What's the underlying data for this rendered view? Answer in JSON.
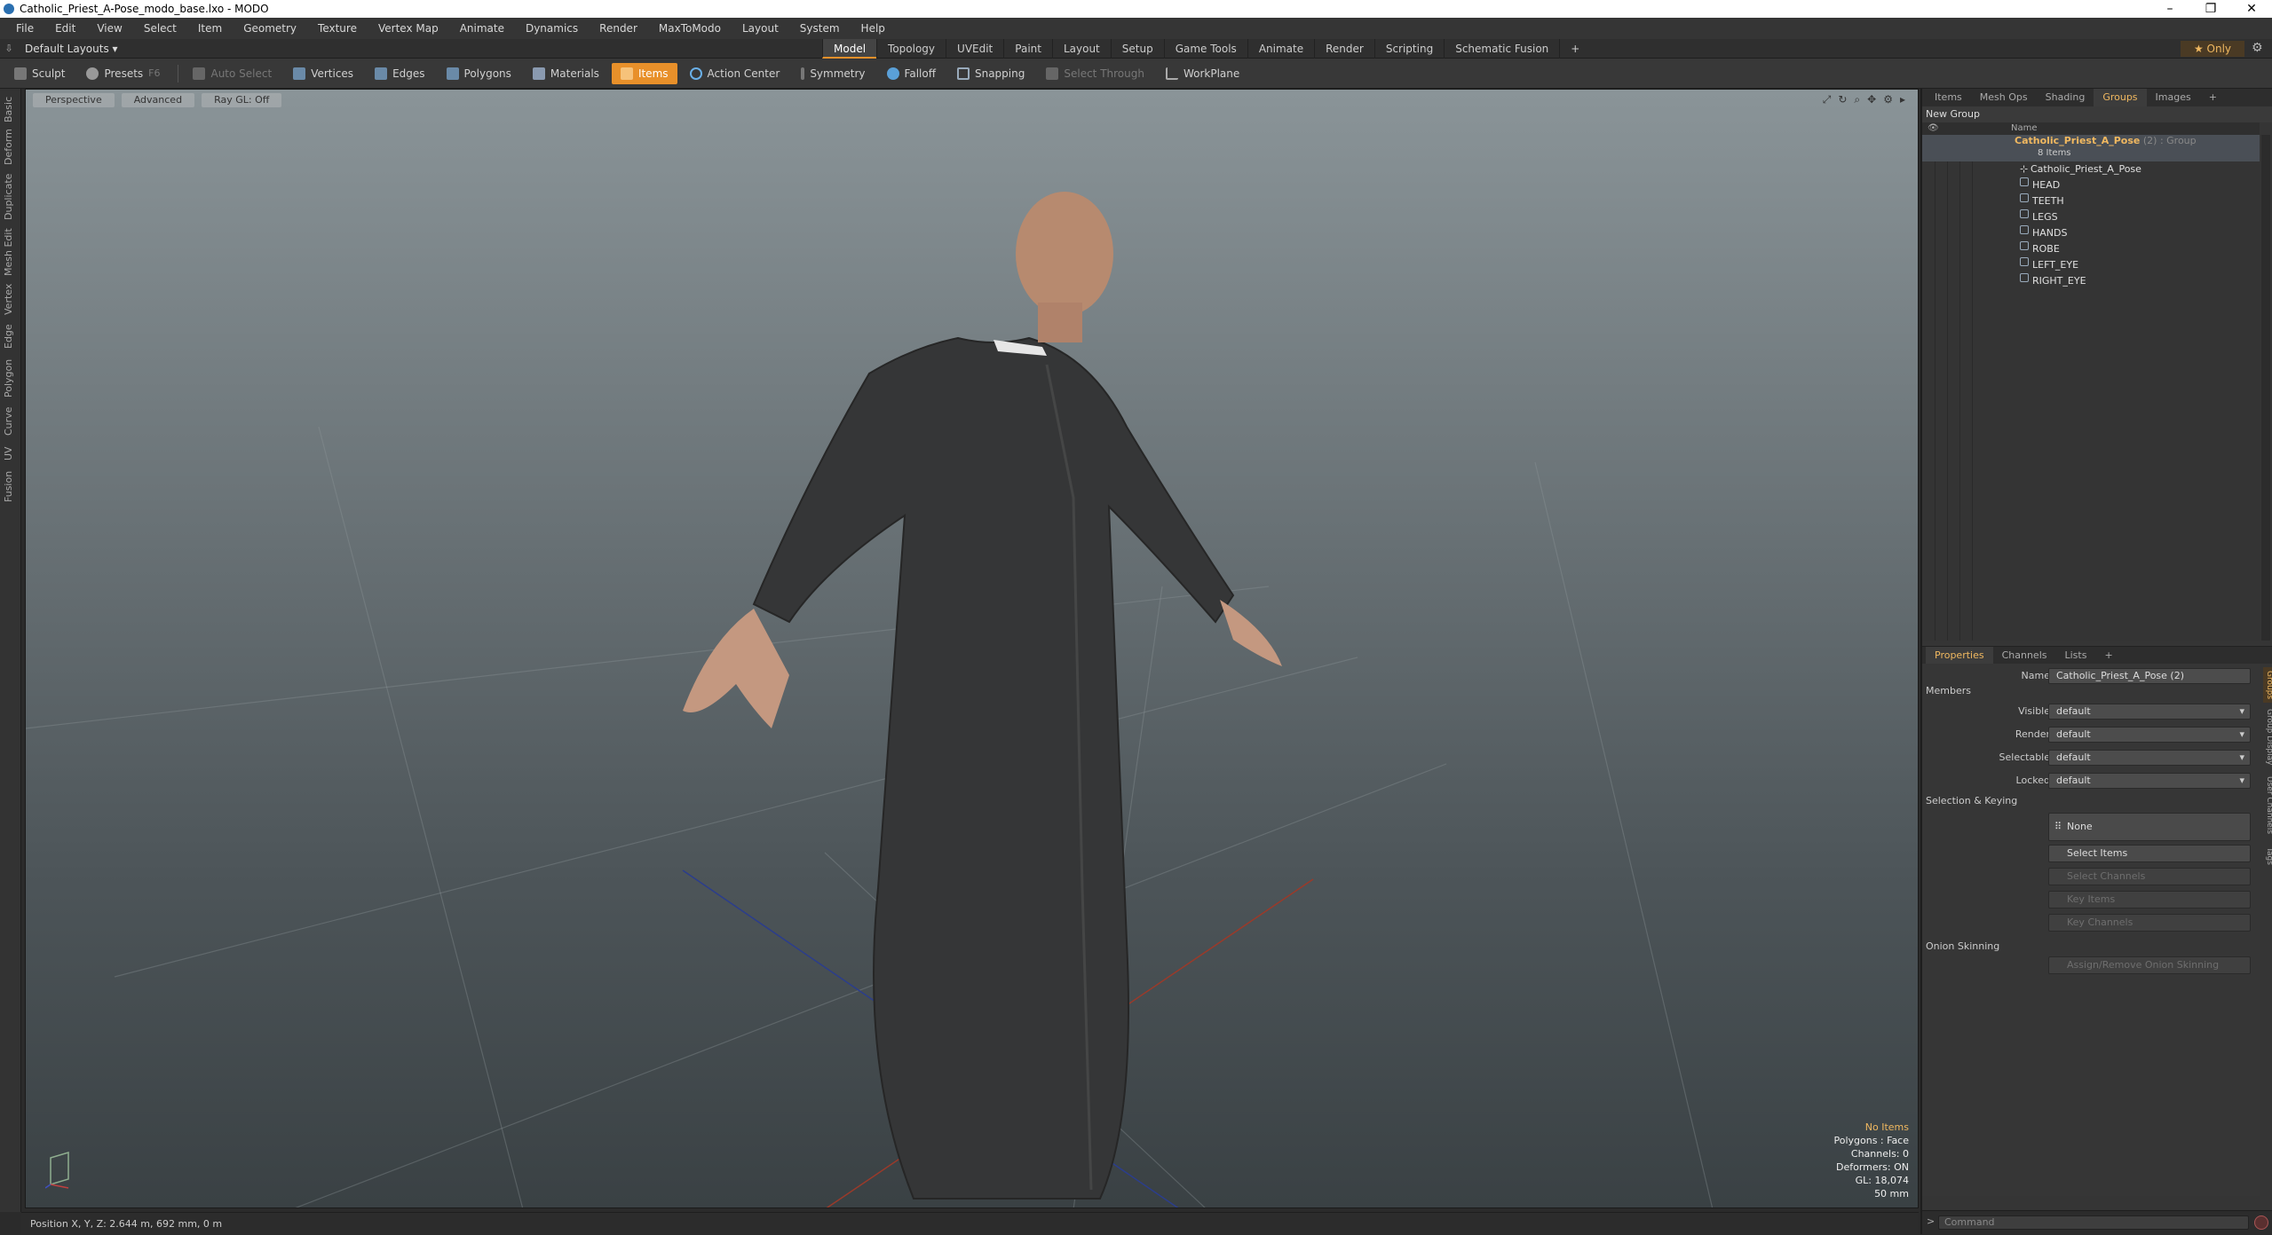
{
  "window": {
    "title": "Catholic_Priest_A-Pose_modo_base.lxo - MODO",
    "minimize": "–",
    "maximize": "❐",
    "close": "✕"
  },
  "menu": [
    "File",
    "Edit",
    "View",
    "Select",
    "Item",
    "Geometry",
    "Texture",
    "Vertex Map",
    "Animate",
    "Dynamics",
    "Render",
    "MaxToModo",
    "Layout",
    "System",
    "Help"
  ],
  "layout": {
    "selector": "Default Layouts ▾"
  },
  "mode_tabs": [
    "Model",
    "Topology",
    "UVEdit",
    "Paint",
    "Layout",
    "Setup",
    "Game Tools",
    "Animate",
    "Render",
    "Scripting",
    "Schematic Fusion",
    "+"
  ],
  "active_mode": "Model",
  "only_button": "★ Only",
  "toolbar": {
    "sculpt": "Sculpt",
    "presets": "Presets",
    "presets_key": "F6",
    "auto_select": "Auto Select",
    "vertices": "Vertices",
    "edges": "Edges",
    "polygons": "Polygons",
    "materials": "Materials",
    "items": "Items",
    "action_center": "Action Center",
    "symmetry": "Symmetry",
    "falloff": "Falloff",
    "snapping": "Snapping",
    "select_through": "Select Through",
    "workplane": "WorkPlane"
  },
  "left_tabs": [
    "Basic",
    "Deform",
    "Duplicate",
    "Mesh Edit",
    "Vertex",
    "Edge",
    "Polygon",
    "Curve",
    "UV",
    "Fusion"
  ],
  "viewport": {
    "view": "Perspective",
    "mode": "Advanced",
    "raygl": "Ray GL: Off",
    "stats": {
      "selection": "No Items",
      "polygons": "Polygons : Face",
      "channels": "Channels: 0",
      "deformers": "Deformers: ON",
      "gl": "GL: 18,074",
      "focal": "50 mm"
    }
  },
  "status": "Position X, Y, Z:   2.644 m, 692 mm, 0 m",
  "scene_panel": {
    "tabs": [
      "Items",
      "Mesh Ops",
      "Shading",
      "Groups",
      "Images",
      "+"
    ],
    "active_tab": "Groups",
    "new_group": "New Group",
    "column_name": "Name",
    "group": {
      "name": "Catholic_Priest_A_Pose",
      "suffix": " (2) : Group",
      "count": "8 Items"
    },
    "items": [
      "Catholic_Priest_A_Pose",
      "HEAD",
      "TEETH",
      "LEGS",
      "HANDS",
      "ROBE",
      "LEFT_EYE",
      "RIGHT_EYE"
    ]
  },
  "properties": {
    "tabs": [
      "Properties",
      "Channels",
      "Lists",
      "+"
    ],
    "active_tab": "Properties",
    "name_label": "Name",
    "name_value": "Catholic_Priest_A_Pose (2)",
    "members_section": "Members",
    "visible_label": "Visible",
    "visible_value": "default",
    "render_label": "Render",
    "render_value": "default",
    "selectable_label": "Selectable",
    "selectable_value": "default",
    "locked_label": "Locked",
    "locked_value": "default",
    "selection_section": "Selection & Keying",
    "none_button": "None",
    "select_items": "Select Items",
    "select_channels": "Select Channels",
    "key_items": "Key Items",
    "key_channels": "Key Channels",
    "onion_section": "Onion Skinning",
    "onion_button": "Assign/Remove Onion Skinning",
    "side_tabs": [
      "Groups",
      "Group Display",
      "User Channels",
      "Tags"
    ]
  },
  "command": {
    "placeholder": "Command"
  },
  "colors": {
    "accent": "#e8902a",
    "group_name": "#f0b860"
  }
}
